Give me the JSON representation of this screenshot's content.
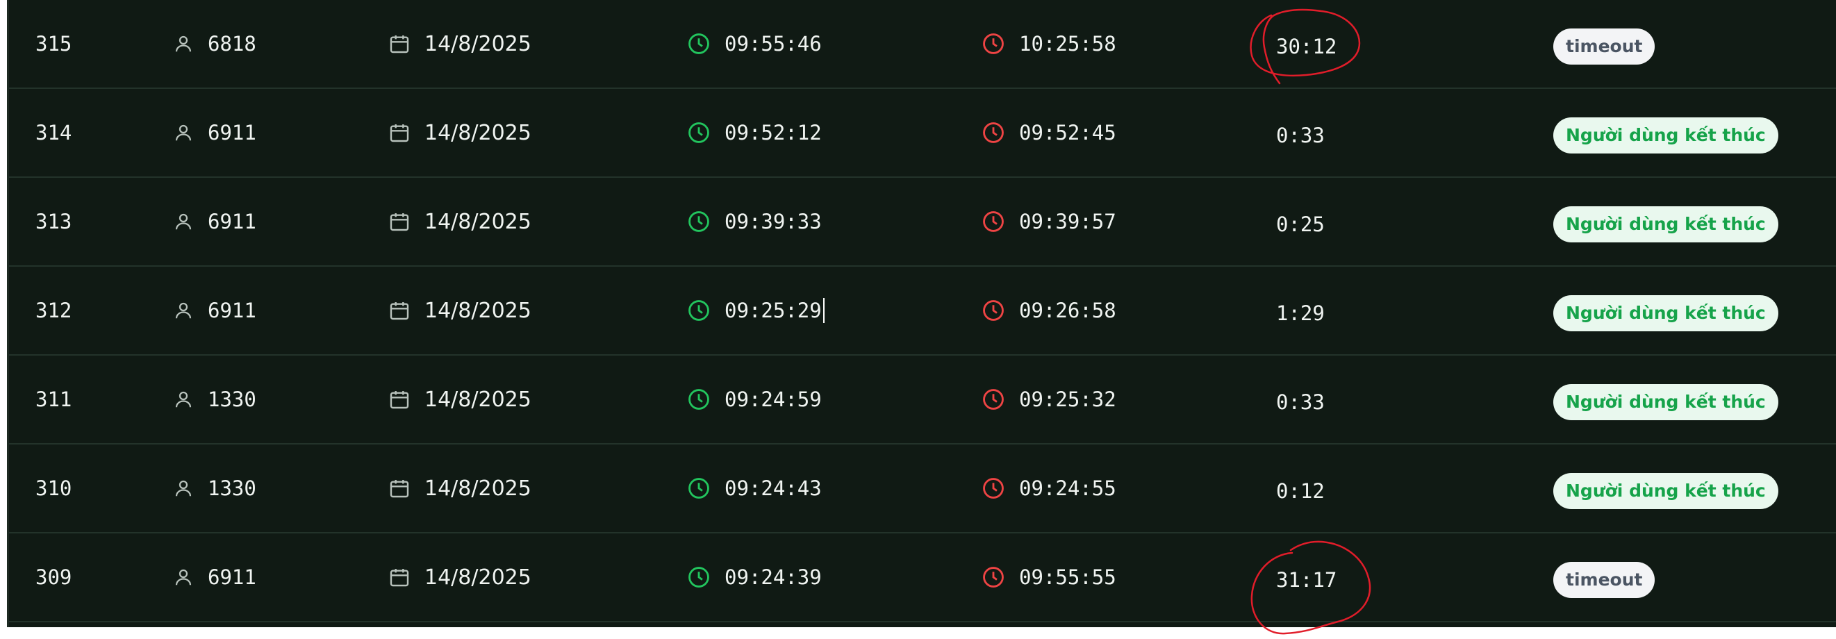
{
  "rows": [
    {
      "id": "315",
      "user": "6818",
      "date": "14/8/2025",
      "start": "09:55:46",
      "end": "10:25:58",
      "duration": "30:12",
      "status": "timeout",
      "status_kind": "timeout",
      "circled": true
    },
    {
      "id": "314",
      "user": "6911",
      "date": "14/8/2025",
      "start": "09:52:12",
      "end": "09:52:45",
      "duration": "0:33",
      "status": "Người dùng kết thúc",
      "status_kind": "user",
      "circled": false
    },
    {
      "id": "313",
      "user": "6911",
      "date": "14/8/2025",
      "start": "09:39:33",
      "end": "09:39:57",
      "duration": "0:25",
      "status": "Người dùng kết thúc",
      "status_kind": "user",
      "circled": false
    },
    {
      "id": "312",
      "user": "6911",
      "date": "14/8/2025",
      "start": "09:25:29",
      "end": "09:26:58",
      "duration": "1:29",
      "status": "Người dùng kết thúc",
      "status_kind": "user",
      "circled": false
    },
    {
      "id": "311",
      "user": "1330",
      "date": "14/8/2025",
      "start": "09:24:59",
      "end": "09:25:32",
      "duration": "0:33",
      "status": "Người dùng kết thúc",
      "status_kind": "user",
      "circled": false
    },
    {
      "id": "310",
      "user": "1330",
      "date": "14/8/2025",
      "start": "09:24:43",
      "end": "09:24:55",
      "duration": "0:12",
      "status": "Người dùng kết thúc",
      "status_kind": "user",
      "circled": false
    },
    {
      "id": "309",
      "user": "6911",
      "date": "14/8/2025",
      "start": "09:24:39",
      "end": "09:55:55",
      "duration": "31:17",
      "status": "timeout",
      "status_kind": "timeout",
      "circled": true
    }
  ],
  "icons": {
    "user": "user-icon",
    "date": "calendar-icon",
    "start": "clock-icon",
    "end": "clock-icon"
  },
  "colors": {
    "start_clock": "#22c55e",
    "end_clock": "#ef4444",
    "annotation": "#e11d2a"
  }
}
